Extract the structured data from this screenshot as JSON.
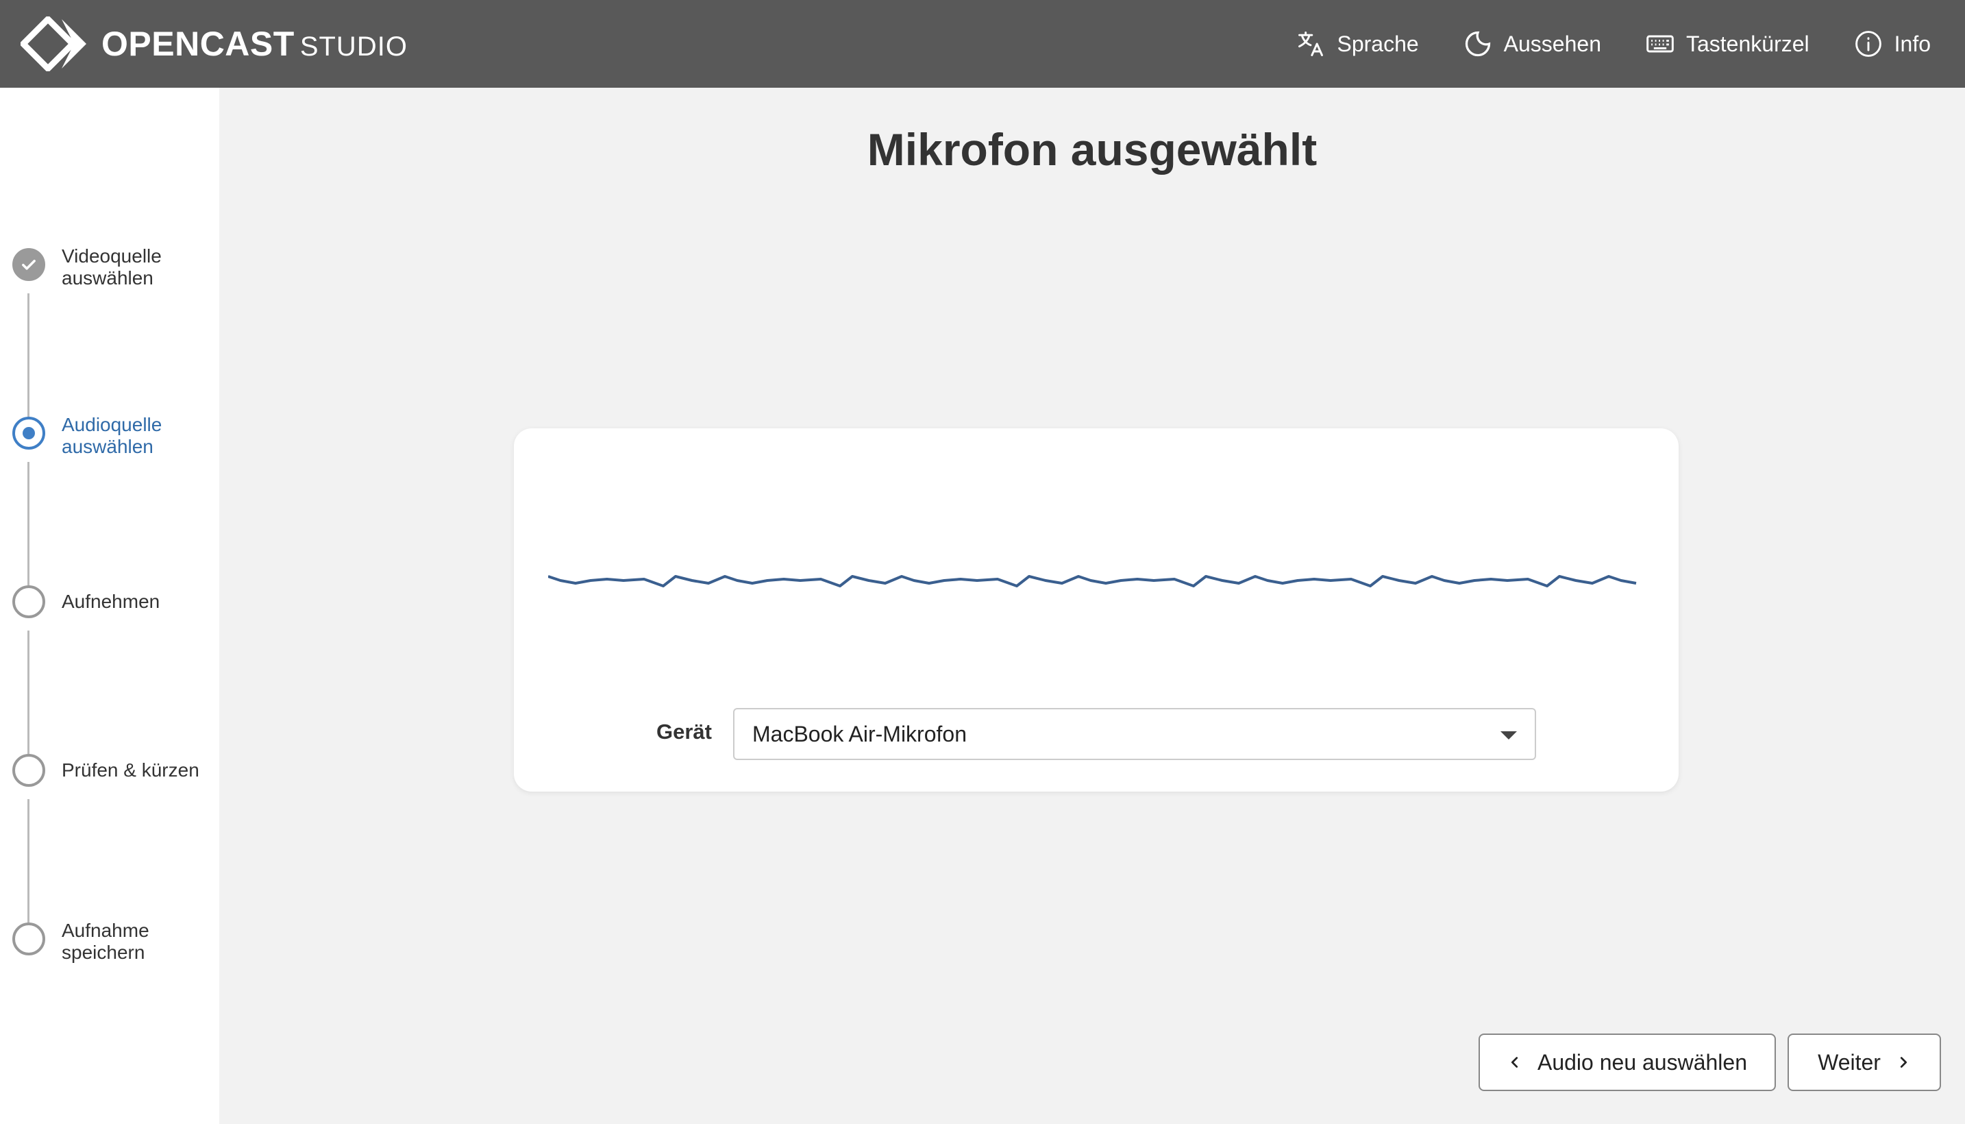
{
  "header": {
    "logo_bold": "OPENCAST",
    "logo_light": "STUDIO",
    "nav": [
      {
        "label": "Sprache",
        "icon": "translate-icon"
      },
      {
        "label": "Aussehen",
        "icon": "moon-icon"
      },
      {
        "label": "Tastenkürzel",
        "icon": "keyboard-icon"
      },
      {
        "label": "Info",
        "icon": "info-icon"
      }
    ]
  },
  "sidebar": {
    "steps": [
      {
        "label": "Videoquelle auswählen",
        "state": "done"
      },
      {
        "label": "Audioquelle auswählen",
        "state": "active"
      },
      {
        "label": "Aufnehmen",
        "state": "pending"
      },
      {
        "label": "Prüfen & kürzen",
        "state": "pending"
      },
      {
        "label": "Aufnahme speichern",
        "state": "pending"
      }
    ]
  },
  "main": {
    "title": "Mikrofon ausgewählt",
    "device_label": "Gerät",
    "device_value": "MacBook Air-Mikrofon"
  },
  "buttons": {
    "back_label": "Audio neu auswählen",
    "next_label": "Weiter"
  },
  "colors": {
    "header_bg": "#595959",
    "accent": "#3f7fc6",
    "waveform": "#3a5f8f",
    "page_bg": "#f2f2f2"
  }
}
